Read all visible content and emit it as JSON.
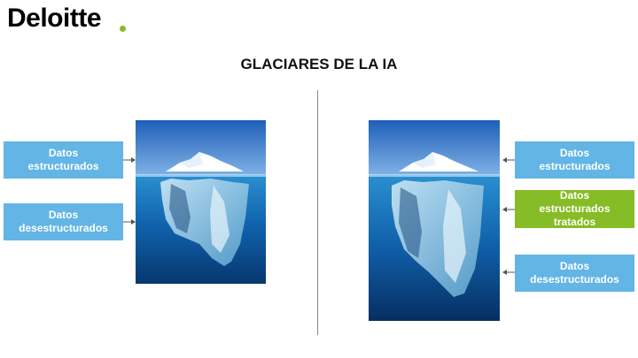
{
  "brand": {
    "name": "Deloitte",
    "dot_color": "#86BC25"
  },
  "title": "GLACIARES DE LA IA",
  "colors": {
    "blue_box": "#62B5E5",
    "green_box": "#86BC25",
    "arrow": "#555555"
  },
  "left_panel": {
    "labels": [
      {
        "line1": "Datos",
        "line2": "estructurados"
      },
      {
        "line1": "Datos",
        "line2": "desestructurados"
      }
    ]
  },
  "right_panel": {
    "labels": [
      {
        "line1": "Datos",
        "line2": "estructurados"
      },
      {
        "line1": "Datos",
        "line2": "estructurados",
        "line3": "tratados"
      },
      {
        "line1": "Datos",
        "line2": "desestructurados"
      }
    ]
  }
}
